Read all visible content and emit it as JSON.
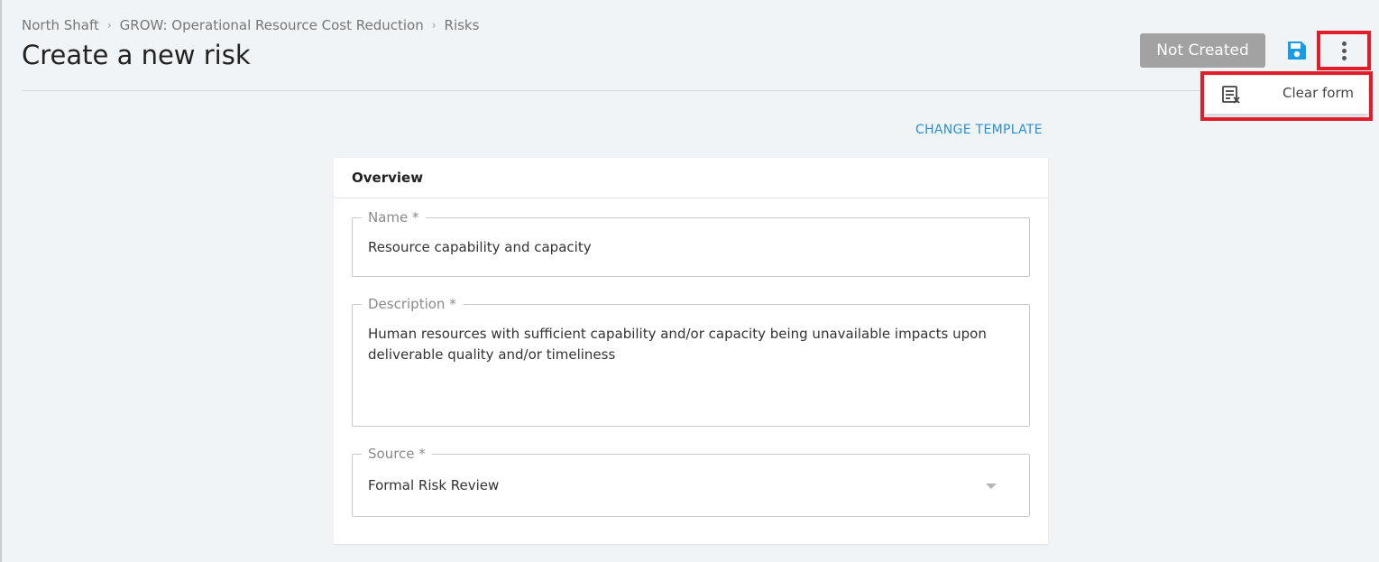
{
  "breadcrumb": {
    "items": [
      "North Shaft",
      "GROW: Operational Resource Cost Reduction",
      "Risks"
    ],
    "separator": "›"
  },
  "page": {
    "title": "Create a new risk"
  },
  "toolbar": {
    "status_label": "Not Created",
    "save_icon": "save-icon",
    "more_icon": "more-vertical-icon"
  },
  "menu": {
    "items": [
      {
        "icon": "clear-form-icon",
        "label": "Clear form"
      }
    ]
  },
  "change_template_label": "CHANGE TEMPLATE",
  "form": {
    "section_title": "Overview",
    "name": {
      "label": "Name *",
      "value": "Resource capability and capacity"
    },
    "description": {
      "label": "Description *",
      "value": "Human resources with sufficient capability and/or capacity being unavailable impacts upon deliverable quality and/or timeliness"
    },
    "source": {
      "label": "Source *",
      "value": "Formal Risk Review"
    }
  },
  "colors": {
    "accent": "#2a8fd8",
    "save_icon": "#1a9be6",
    "status_bg": "#a2a2a2",
    "highlight": "#e11d2a",
    "background": "#f1f4f7"
  }
}
